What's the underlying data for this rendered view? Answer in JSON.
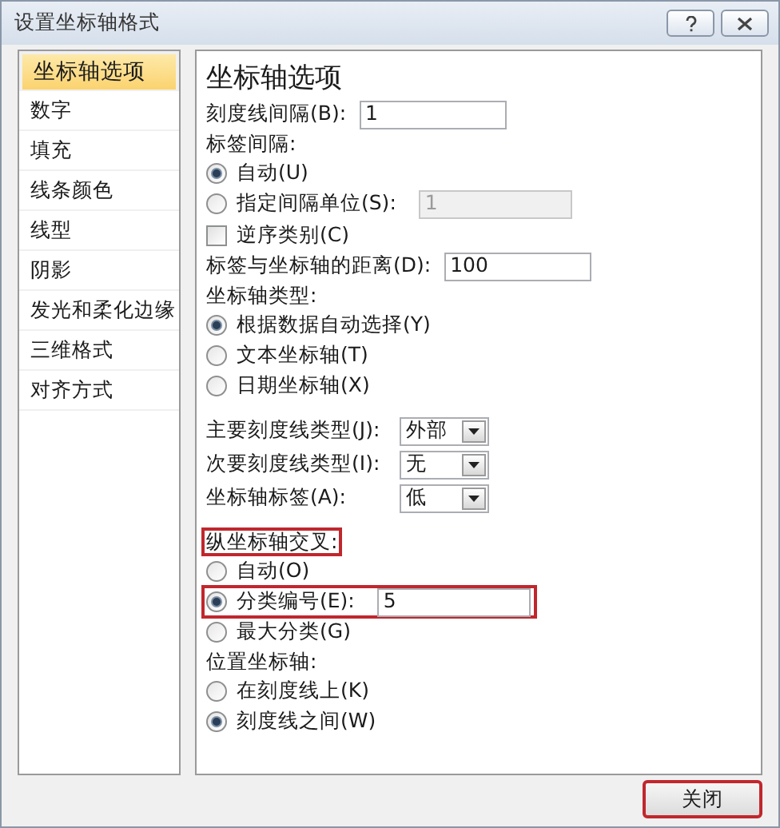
{
  "window": {
    "title": "设置坐标轴格式"
  },
  "sidebar": {
    "items": [
      {
        "label": "坐标轴选项",
        "selected": true,
        "highlighted": true
      },
      {
        "label": "数字",
        "selected": false,
        "highlighted": false
      },
      {
        "label": "填充",
        "selected": false,
        "highlighted": false
      },
      {
        "label": "线条颜色",
        "selected": false,
        "highlighted": false
      },
      {
        "label": "线型",
        "selected": false,
        "highlighted": false
      },
      {
        "label": "阴影",
        "selected": false,
        "highlighted": false
      },
      {
        "label": "发光和柔化边缘",
        "selected": false,
        "highlighted": false
      },
      {
        "label": "三维格式",
        "selected": false,
        "highlighted": false
      },
      {
        "label": "对齐方式",
        "selected": false,
        "highlighted": false
      }
    ]
  },
  "panel": {
    "heading": "坐标轴选项",
    "rows": [
      {
        "kind": "field",
        "label": "刻度线间隔(B):",
        "value": "1"
      },
      {
        "kind": "label",
        "text": "标签间隔:",
        "highlighted": false
      },
      {
        "kind": "radio",
        "label": "自动(U)",
        "selected": true,
        "highlighted": false
      },
      {
        "kind": "radio",
        "label": "指定间隔单位(S):",
        "selected": false,
        "highlighted": false,
        "value": "1",
        "disabled": true
      },
      {
        "kind": "checkbox",
        "label": "逆序类别(C)",
        "checked": false
      },
      {
        "kind": "field",
        "label": "标签与坐标轴的距离(D):",
        "value": "100"
      },
      {
        "kind": "label",
        "text": "坐标轴类型:",
        "highlighted": false
      },
      {
        "kind": "radio",
        "label": "根据数据自动选择(Y)",
        "selected": true,
        "highlighted": false
      },
      {
        "kind": "radio",
        "label": "文本坐标轴(T)",
        "selected": false,
        "highlighted": false
      },
      {
        "kind": "radio",
        "label": "日期坐标轴(X)",
        "selected": false,
        "highlighted": false
      },
      {
        "kind": "divider"
      },
      {
        "kind": "select",
        "label": "主要刻度线类型(J):",
        "value": "外部"
      },
      {
        "kind": "select",
        "label": "次要刻度线类型(I):",
        "value": "无"
      },
      {
        "kind": "select",
        "label": "坐标轴标签(A):",
        "value": "低"
      },
      {
        "kind": "divider"
      },
      {
        "kind": "label",
        "text": "纵坐标轴交叉:",
        "highlighted": true
      },
      {
        "kind": "radio",
        "label": "自动(O)",
        "selected": false,
        "highlighted": false
      },
      {
        "kind": "radio",
        "label": "分类编号(E):",
        "selected": true,
        "highlighted": true,
        "value": "5",
        "disabled": false
      },
      {
        "kind": "radio",
        "label": "最大分类(G)",
        "selected": false,
        "highlighted": false
      },
      {
        "kind": "label",
        "text": "位置坐标轴:",
        "highlighted": false
      },
      {
        "kind": "radio",
        "label": "在刻度线上(K)",
        "selected": false,
        "highlighted": false
      },
      {
        "kind": "radio",
        "label": "刻度线之间(W)",
        "selected": true,
        "highlighted": false
      }
    ]
  },
  "buttons": [
    {
      "label": "关闭",
      "highlighted": true
    }
  ]
}
